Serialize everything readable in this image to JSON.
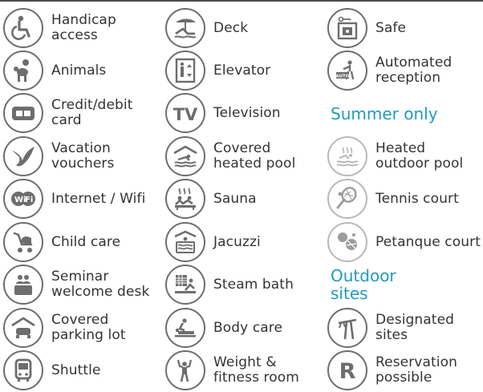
{
  "columns": [
    {
      "items": [
        {
          "icon": "wheelchair-icon",
          "label": "Handicap access"
        },
        {
          "icon": "poodle-icon",
          "label": "Animals"
        },
        {
          "icon": "credit-card-icon",
          "label": "Credit/debit card"
        },
        {
          "icon": "bird-icon",
          "label": "Vacation vouchers"
        },
        {
          "icon": "wifi-icon",
          "label": "Internet / Wifi"
        },
        {
          "icon": "stroller-icon",
          "label": "Child care"
        },
        {
          "icon": "people-desk-icon",
          "label": "Seminar welcome desk"
        },
        {
          "icon": "car-shelter-icon",
          "label": "Covered parking lot"
        },
        {
          "icon": "bus-icon",
          "label": "Shuttle"
        }
      ]
    },
    {
      "items": [
        {
          "icon": "deckchair-icon",
          "label": "Deck"
        },
        {
          "icon": "elevator-icon",
          "label": "Elevator"
        },
        {
          "icon": "tv-icon",
          "label": "Television",
          "icon_text": "TV"
        },
        {
          "icon": "covered-pool-icon",
          "label": "Covered heated pool"
        },
        {
          "icon": "sauna-icon",
          "label": "Sauna"
        },
        {
          "icon": "jacuzzi-icon",
          "label": "Jacuzzi"
        },
        {
          "icon": "steam-bath-icon",
          "label": "Steam bath"
        },
        {
          "icon": "massage-icon",
          "label": "Body care"
        },
        {
          "icon": "fitness-icon",
          "label": "Weight & fitness room"
        }
      ]
    },
    {
      "items": [
        {
          "icon": "safe-icon",
          "label": "Safe"
        },
        {
          "icon": "auto-reception-icon",
          "label": "Automated reception",
          "icon_text": "AUTO"
        }
      ],
      "sections": [
        {
          "title": "Summer only",
          "items": [
            {
              "icon": "heated-outdoor-pool-icon",
              "label": "Heated outdoor pool"
            },
            {
              "icon": "tennis-icon",
              "label": "Tennis court"
            },
            {
              "icon": "petanque-icon",
              "label": "Petanque court"
            }
          ]
        },
        {
          "title": "Outdoor sites",
          "items": [
            {
              "icon": "designated-sites-icon",
              "label": "Designated sites"
            },
            {
              "icon": "reservation-icon",
              "label": "Reservation possible",
              "icon_text": "R"
            }
          ]
        }
      ]
    }
  ],
  "colors": {
    "accent": "#1e9bc1",
    "icon_dark": "#6d6d6d",
    "icon_light": "#b8b8b8",
    "text": "#333333"
  }
}
